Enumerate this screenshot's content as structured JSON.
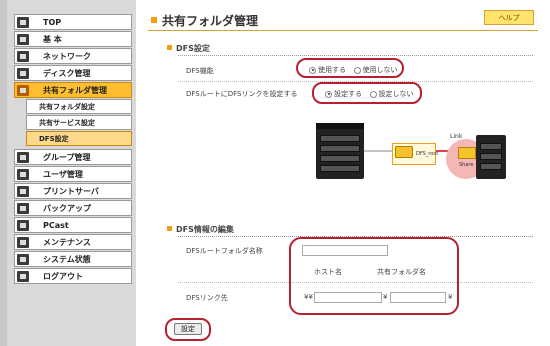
{
  "sidebar": {
    "items": [
      {
        "label": "TOP",
        "icon": "top-icon"
      },
      {
        "label": "基 本",
        "icon": "basic-icon"
      },
      {
        "label": "ネットワーク",
        "icon": "network-icon"
      },
      {
        "label": "ディスク管理",
        "icon": "disk-icon"
      },
      {
        "label": "共有フォルダ管理",
        "icon": "shared-folder-icon",
        "active": true
      },
      {
        "label": "グループ管理",
        "icon": "group-icon"
      },
      {
        "label": "ユーザ管理",
        "icon": "user-icon"
      },
      {
        "label": "プリントサーバ",
        "icon": "printer-icon"
      },
      {
        "label": "バックアップ",
        "icon": "backup-icon"
      },
      {
        "label": "PCast",
        "icon": "pcast-icon"
      },
      {
        "label": "メンテナンス",
        "icon": "maintenance-icon"
      },
      {
        "label": "システム状態",
        "icon": "system-status-icon"
      },
      {
        "label": "ログアウト",
        "icon": "logout-icon"
      }
    ],
    "sub_items": [
      {
        "label": "共有フォルダ設定"
      },
      {
        "label": "共有サービス設定"
      },
      {
        "label": "DFS設定",
        "active": true
      }
    ]
  },
  "header": {
    "title": "共有フォルダ管理",
    "help_label": "ヘルプ"
  },
  "dfs_settings": {
    "heading": "DFS設定",
    "function_label": "DFS機能",
    "function_options": [
      "使用する",
      "使用しない"
    ],
    "function_selected": "使用する",
    "root_link_label": "DFSルートにDFSリンクを設定する",
    "root_link_options": [
      "設定する",
      "設定しない"
    ],
    "root_link_selected": "設定する"
  },
  "diagram": {
    "root_folder": "DFS_root",
    "link_label": "Link",
    "share_label": "Share"
  },
  "dfs_info": {
    "heading": "DFS情報の編集",
    "root_folder_label": "DFSルートフォルダ名称",
    "root_folder_value": "",
    "host_header": "ホスト名",
    "share_header": "共有フォルダ名",
    "link_label": "DFSリンク先",
    "host_value": "",
    "share_value": "",
    "prefix": "¥¥",
    "separator": "¥"
  },
  "save_label": "設定",
  "colors": {
    "accent": "#f29d16",
    "active_nav": "#ffbe2e",
    "highlight_ring": "#b8202e"
  }
}
